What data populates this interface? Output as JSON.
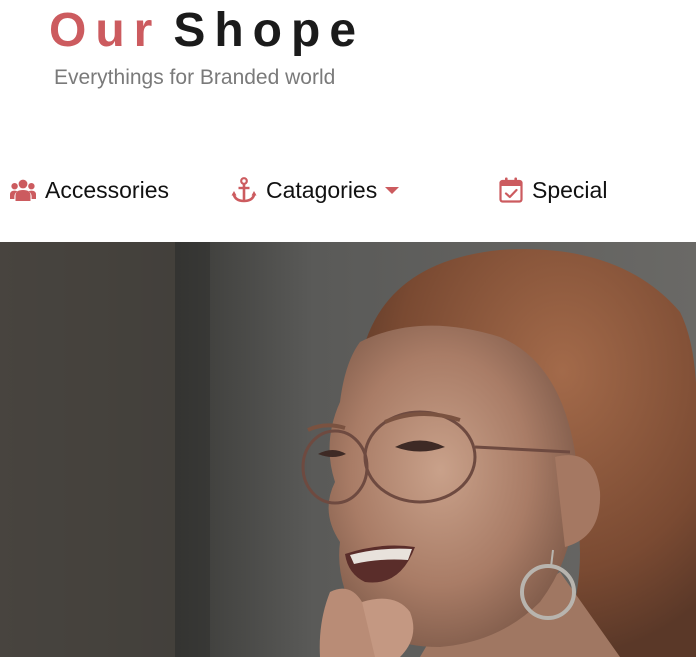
{
  "brand": {
    "title_first": "Our",
    "title_second": "Shope",
    "tagline": "Everythings for Branded world"
  },
  "nav": {
    "items": [
      {
        "label": "Accessories",
        "icon": "users-icon"
      },
      {
        "label": "Catagories",
        "icon": "anchor-icon",
        "has_dropdown": true
      },
      {
        "label": "Special",
        "icon": "calendar-check-icon"
      }
    ]
  },
  "hero": {
    "image": "woman-with-glasses-smiling-photo"
  },
  "colors": {
    "accent": "#cc5b5f",
    "text_dark": "#1b1b1b",
    "tagline": "#7a7a7a"
  }
}
